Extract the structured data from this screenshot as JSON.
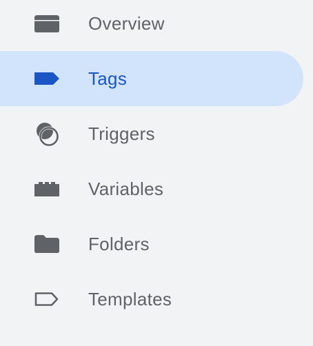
{
  "sidebar": {
    "items": [
      {
        "label": "Overview",
        "icon": "overview-icon",
        "active": false
      },
      {
        "label": "Tags",
        "icon": "tag-icon",
        "active": true
      },
      {
        "label": "Triggers",
        "icon": "trigger-icon",
        "active": false
      },
      {
        "label": "Variables",
        "icon": "variables-icon",
        "active": false
      },
      {
        "label": "Folders",
        "icon": "folder-icon",
        "active": false
      },
      {
        "label": "Templates",
        "icon": "template-icon",
        "active": false
      }
    ]
  },
  "colors": {
    "background": "#f1f3f4",
    "active_background": "#d2e3fc",
    "active_text": "#1a56c4",
    "text": "#5f6368",
    "icon": "#5f6368"
  }
}
